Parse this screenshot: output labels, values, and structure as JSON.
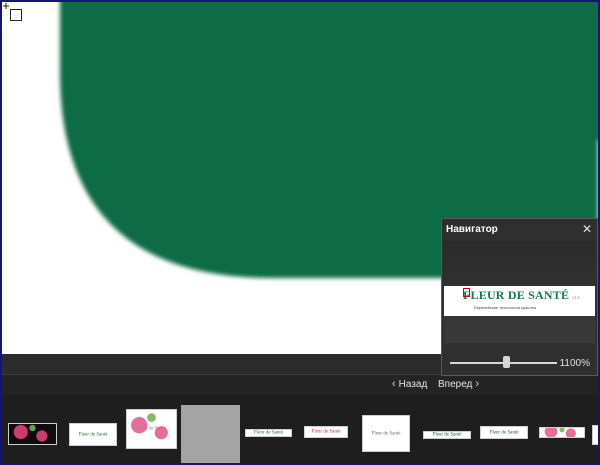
{
  "navigator": {
    "title": "Навигатор",
    "close_icon": "close-icon",
    "zoom": "1100%",
    "zoom_fraction": 0.52,
    "logo_text": "FLEUR DE SANTÉ",
    "logo_suffix": "LLC",
    "logo_subtitle": "Европейские технологии красоты"
  },
  "nav": {
    "back_label": "Назад",
    "forward_label": "Вперед",
    "back_icon": "chevron-left-icon",
    "forward_icon": "chevron-right-icon"
  },
  "canvas": {
    "shape_color": "#106c44",
    "background": "#ffffff"
  },
  "filmstrip": {
    "thumbnails": [
      {
        "name": "thumb-1",
        "selected": false,
        "caption": ""
      },
      {
        "name": "thumb-2",
        "selected": false,
        "caption": "Fleur de Santé"
      },
      {
        "name": "thumb-3",
        "selected": false,
        "caption": "Fleur de Santé"
      },
      {
        "name": "thumb-4",
        "selected": true,
        "caption": ""
      },
      {
        "name": "thumb-5",
        "selected": false,
        "caption": "Fleur de Santé"
      },
      {
        "name": "thumb-6",
        "selected": false,
        "caption": "Fleur de Santé"
      },
      {
        "name": "thumb-7",
        "selected": false,
        "caption": "Fleur de Santé"
      },
      {
        "name": "thumb-8",
        "selected": false,
        "caption": "Fleur de Santé"
      },
      {
        "name": "thumb-9",
        "selected": false,
        "caption": "Fleur de Santé"
      },
      {
        "name": "thumb-10",
        "selected": false,
        "caption": ""
      },
      {
        "name": "thumb-11",
        "selected": false,
        "caption": ""
      }
    ]
  }
}
